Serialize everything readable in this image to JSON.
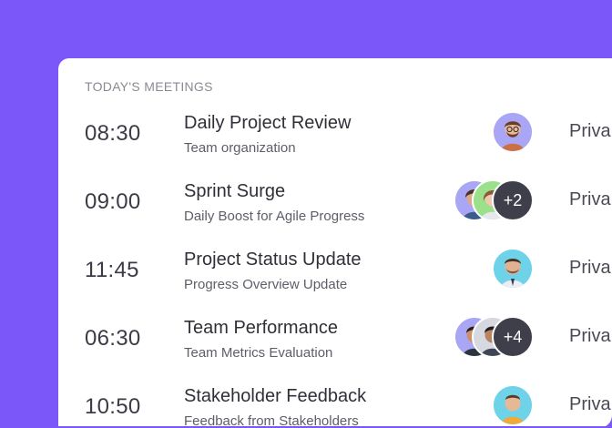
{
  "section": {
    "title": "TODAY'S MEETINGS"
  },
  "meetings": [
    {
      "time": "08:30",
      "title": "Daily Project Review",
      "subtitle": "Team organization",
      "privacy": "Priva",
      "extra": ""
    },
    {
      "time": "09:00",
      "title": "Sprint Surge",
      "subtitle": "Daily Boost for Agile Progress",
      "privacy": "Priva",
      "extra": "+2"
    },
    {
      "time": "11:45",
      "title": "Project Status Update",
      "subtitle": "Progress Overview Update",
      "privacy": "Priva",
      "extra": ""
    },
    {
      "time": "06:30",
      "title": "Team Performance",
      "subtitle": "Team Metrics Evaluation",
      "privacy": "Priva",
      "extra": "+4"
    },
    {
      "time": "10:50",
      "title": "Stakeholder Feedback",
      "subtitle": "Feedback from Stakeholders",
      "privacy": "Priva",
      "extra": ""
    }
  ],
  "colors": {
    "background": "#7B57F9",
    "card": "#FFFFFF",
    "more_badge": "#3F3F4C"
  }
}
